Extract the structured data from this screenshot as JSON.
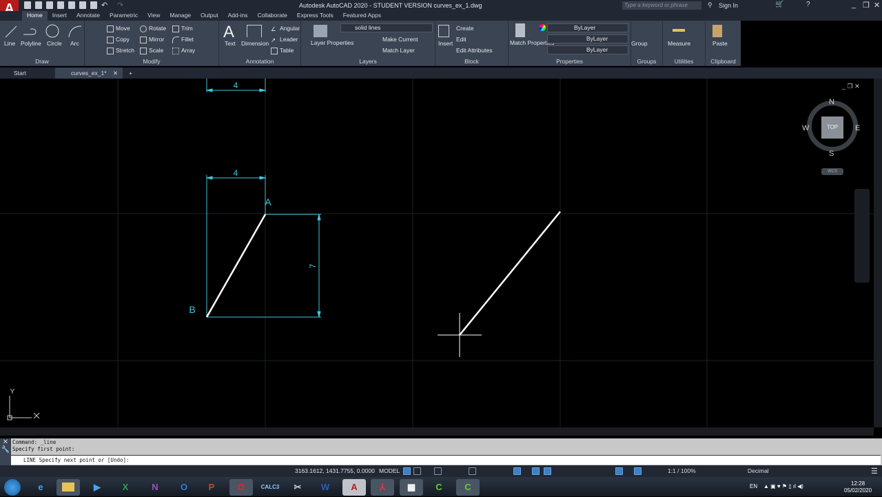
{
  "app": {
    "title": "Autodesk AutoCAD 2020 - STUDENT VERSION    curves_ex_1.dwg",
    "logo": "A",
    "search_placeholder": "Type a keyword or phrase",
    "sign_in": "Sign In"
  },
  "ribbon_tabs": [
    "Home",
    "Insert",
    "Annotate",
    "Parametric",
    "View",
    "Manage",
    "Output",
    "Add-ins",
    "Collaborate",
    "Express Tools",
    "Featured Apps"
  ],
  "draw": {
    "title": "Draw",
    "line": "Line",
    "polyline": "Polyline",
    "circle": "Circle",
    "arc": "Arc"
  },
  "modify": {
    "title": "Modify",
    "move": "Move",
    "copy": "Copy",
    "stretch": "Stretch",
    "rotate": "Rotate",
    "mirror": "Mirror",
    "scale": "Scale",
    "trim": "Trim",
    "fillet": "Fillet",
    "array": "Array"
  },
  "annotation": {
    "title": "Annotation",
    "text": "Text",
    "dimension": "Dimension",
    "angular": "Angular",
    "leader": "Leader",
    "table": "Table"
  },
  "layers": {
    "title": "Layers",
    "layer_properties": "Layer Properties",
    "current_layer": "solid lines",
    "make_current": "Make Current",
    "match_layer": "Match Layer"
  },
  "block": {
    "title": "Block",
    "insert": "Insert",
    "create": "Create",
    "edit": "Edit",
    "edit_attributes": "Edit Attributes"
  },
  "properties": {
    "title": "Properties",
    "match_properties": "Match Properties",
    "color": "ByLayer",
    "linetype": "ByLayer",
    "lineweight": "ByLayer"
  },
  "groups": {
    "title": "Groups",
    "group": "Group"
  },
  "utilities": {
    "title": "Utilities",
    "measure": "Measure"
  },
  "clipboard": {
    "title": "Clipboard",
    "paste": "Paste"
  },
  "file_tabs": {
    "start": "Start",
    "current": "curves_ex_1*"
  },
  "drawing": {
    "dim_top": "4",
    "dim_mid": "4",
    "dim_right": "7",
    "label_a": "A",
    "label_b": "B",
    "ucs_y": "Y",
    "line_color": "#ffffff",
    "dim_color": "#3fc8e0"
  },
  "viewcube": {
    "n": "N",
    "s": "S",
    "e": "E",
    "w": "W",
    "face": "TOP",
    "wcs": "WCS"
  },
  "command": {
    "history": [
      "Command: _line",
      "Specify first point:"
    ],
    "prompt": "LINE Specify next point or [Undo]:"
  },
  "status": {
    "coords": "3163.1612, 1431.7755, 0.0000",
    "space": "MODEL",
    "scale": "1:1 / 100%",
    "units": "Decimal"
  },
  "taskbar": {
    "lang": "EN",
    "time": "12:28",
    "date": "05/02/2020",
    "apps": [
      "IE",
      "Explorer",
      "Media",
      "Excel",
      "OneNote",
      "Outlook",
      "PowerPoint",
      "Opera",
      "Calc3",
      "Snipping",
      "Word",
      "AutoCAD",
      "Acrobat",
      "Calculator",
      "Camtasia",
      "Camtasia Recorder"
    ]
  }
}
